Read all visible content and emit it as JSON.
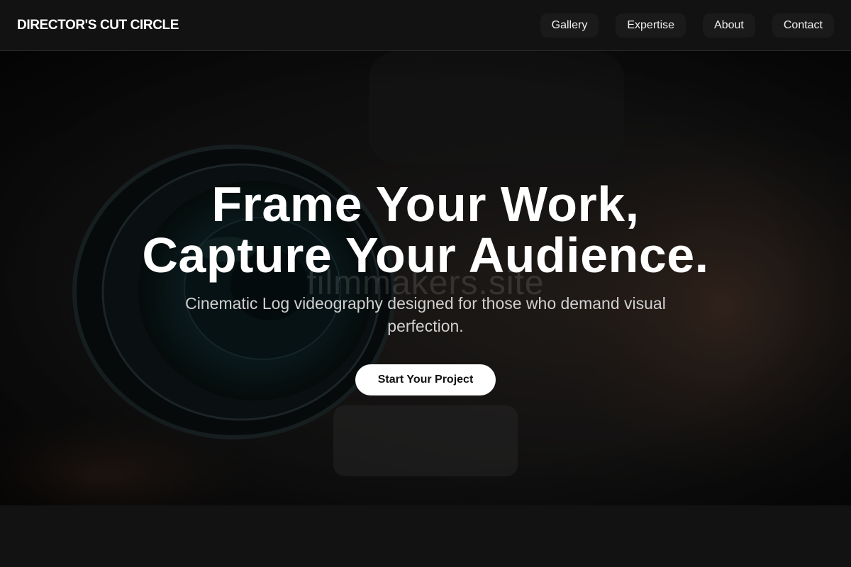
{
  "nav": {
    "brand": "DIRECTOR'S CUT CIRCLE",
    "links": [
      "Gallery",
      "Expertise",
      "About",
      "Contact"
    ]
  },
  "hero": {
    "title_line1": "Frame Your Work,",
    "title_line2": "Capture Your Audience.",
    "subtitle": "Cinematic Log videography designed for those who demand visual perfection.",
    "cta_label": "Start Your Project",
    "watermark": "filmmakers.site"
  },
  "next_section": {
    "heading": ""
  },
  "colors": {
    "page_background": "#121212",
    "text_primary": "#ffffff",
    "text_secondary": "#d0d0d0",
    "button_background": "#ffffff",
    "button_text": "#111111"
  },
  "icons": [
    "camera-lens-image"
  ]
}
